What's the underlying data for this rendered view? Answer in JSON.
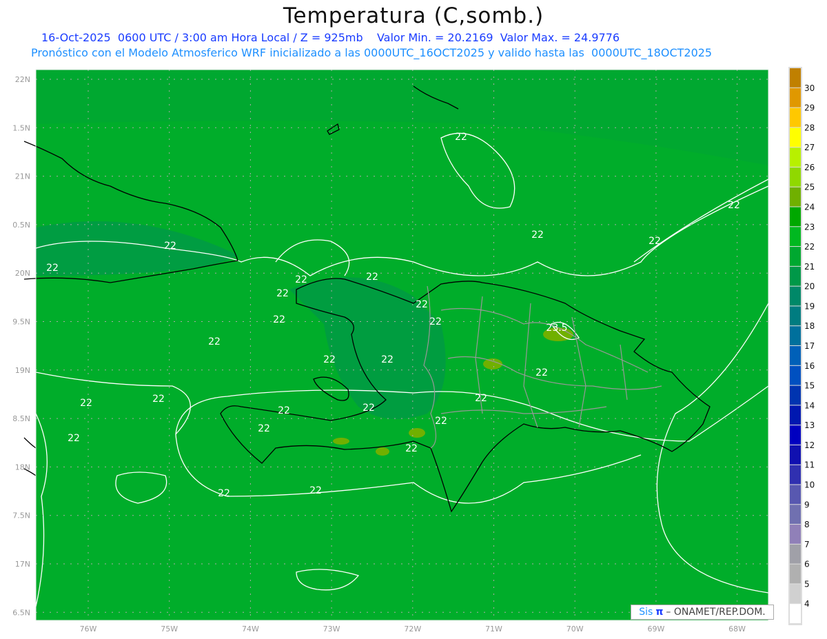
{
  "title": "Temperatura (C,somb.)",
  "subtitle_line1": "16-Oct-2025  0600 UTC / 3:00 am Hora Local / Z = 925mb    Valor Min. = 20.2169  Valor Max. = 24.9776",
  "subtitle_line2": "Pronóstico con el Modelo Atmosferico WRF inicializado a las 0000UTC_16OCT2025 y valido hasta las  0000UTC_18OCT2025",
  "lat_labels": [
    "22N",
    "1.5N",
    "21N",
    "0.5N",
    "20N",
    "9.5N",
    "19N",
    "8.5N",
    "18N",
    "7.5N",
    "17N",
    "6.5N"
  ],
  "lon_labels": [
    "76W",
    "75W",
    "74W",
    "73W",
    "72W",
    "71W",
    "70W",
    "69W",
    "68W"
  ],
  "contour_labels": [
    "22",
    "22",
    "22",
    "22",
    "22",
    "22",
    "22",
    "22",
    "22",
    "22",
    "22",
    "22",
    "22",
    "22",
    "22",
    "22",
    "22",
    "22",
    "22",
    "22",
    "22",
    "22",
    "22",
    "22",
    "22",
    "22",
    "22",
    "23.5"
  ],
  "colorbar": {
    "labels": [
      "30",
      "29",
      "28",
      "27",
      "26",
      "25",
      "24",
      "23",
      "22",
      "21",
      "20",
      "19",
      "18",
      "17",
      "16",
      "15",
      "14",
      "13",
      "12",
      "11",
      "10",
      "9",
      "8",
      "7",
      "6",
      "5",
      "4"
    ],
    "colors": [
      "#c08000",
      "#e09800",
      "#ffc800",
      "#ffff00",
      "#b8f000",
      "#90d800",
      "#70b000",
      "#00a800",
      "#00b820",
      "#00a830",
      "#009848",
      "#008868",
      "#007c80",
      "#00709c",
      "#0060b8",
      "#0050c0",
      "#0034b0",
      "#0018b0",
      "#0000c0",
      "#1010b0",
      "#3030b0",
      "#5858b0",
      "#7070b0",
      "#9080b8",
      "#a0a0a8",
      "#b0b0b0",
      "#d0d0d0",
      "#ffffff"
    ]
  },
  "watermark": {
    "sis": "Sis",
    "pi": "π",
    "org": "– ONAMET/REP.DOM."
  },
  "field_colors": {
    "base": "#00a830",
    "dark": "#009848",
    "warm": "#70b000"
  }
}
